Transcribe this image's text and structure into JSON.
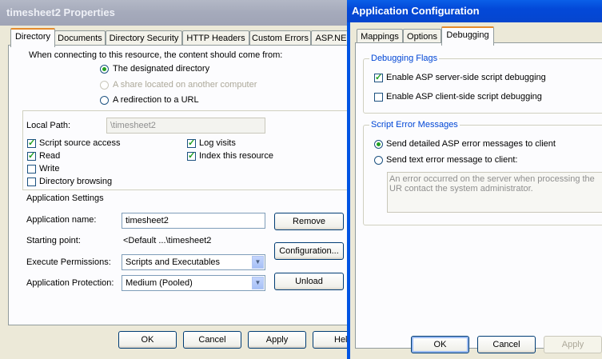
{
  "properties": {
    "title": "timesheet2 Properties",
    "tabs": [
      "Directory",
      "Documents",
      "Directory Security",
      "HTTP Headers",
      "Custom Errors",
      "ASP.NE"
    ],
    "connect_label": "When connecting to this resource, the content should come from:",
    "source_options": [
      "The designated directory",
      "A share located on another computer",
      "A redirection to a URL"
    ],
    "selected_source": "The designated directory",
    "local_path_label": "Local Path:",
    "local_path_value": "\\timesheet2",
    "checks": {
      "script_source_access": {
        "label": "Script source access",
        "checked": true
      },
      "read": {
        "label": "Read",
        "checked": true
      },
      "write": {
        "label": "Write",
        "checked": false
      },
      "directory_browsing": {
        "label": "Directory browsing",
        "checked": false
      },
      "log_visits": {
        "label": "Log visits",
        "checked": true
      },
      "index_this_resource": {
        "label": "Index this resource",
        "checked": true
      }
    },
    "app_settings_label": "Application Settings",
    "app_name_label": "Application name:",
    "app_name_value": "timesheet2",
    "starting_point_label": "Starting point:",
    "starting_point_value": "<Default ...\\timesheet2",
    "execute_permissions_label": "Execute Permissions:",
    "execute_permissions_value": "Scripts and Executables",
    "app_protection_label": "Application Protection:",
    "app_protection_value": "Medium (Pooled)",
    "remove_label": "Remove",
    "configuration_label": "Configuration...",
    "unload_label": "Unload",
    "ok_label": "OK",
    "cancel_label": "Cancel",
    "apply_label": "Apply",
    "help_label": "Hel"
  },
  "app_config": {
    "title": "Application Configuration",
    "tabs": [
      "Mappings",
      "Options",
      "Debugging"
    ],
    "active_tab": "Debugging",
    "debugging_flags_label": "Debugging Flags",
    "server_debug": {
      "label": "Enable ASP server-side script debugging",
      "checked": true
    },
    "client_debug": {
      "label": "Enable ASP client-side script debugging",
      "checked": false
    },
    "script_error_label": "Script Error Messages",
    "error_options": [
      "Send detailed ASP error messages to client",
      "Send text error message to client:"
    ],
    "selected_error_option": "Send detailed ASP error messages to client",
    "error_text": "An error occurred on the server when processing the UR contact the system administrator.",
    "ok_label": "OK",
    "cancel_label": "Cancel",
    "apply_label": "Apply"
  },
  "colors": {
    "xp_title_active": "#0054e3",
    "xp_title_inactive": "#a5aabb",
    "tab_highlight": "#e68b2c",
    "group_title": "#0046d5",
    "check_mark": "#21a121"
  }
}
